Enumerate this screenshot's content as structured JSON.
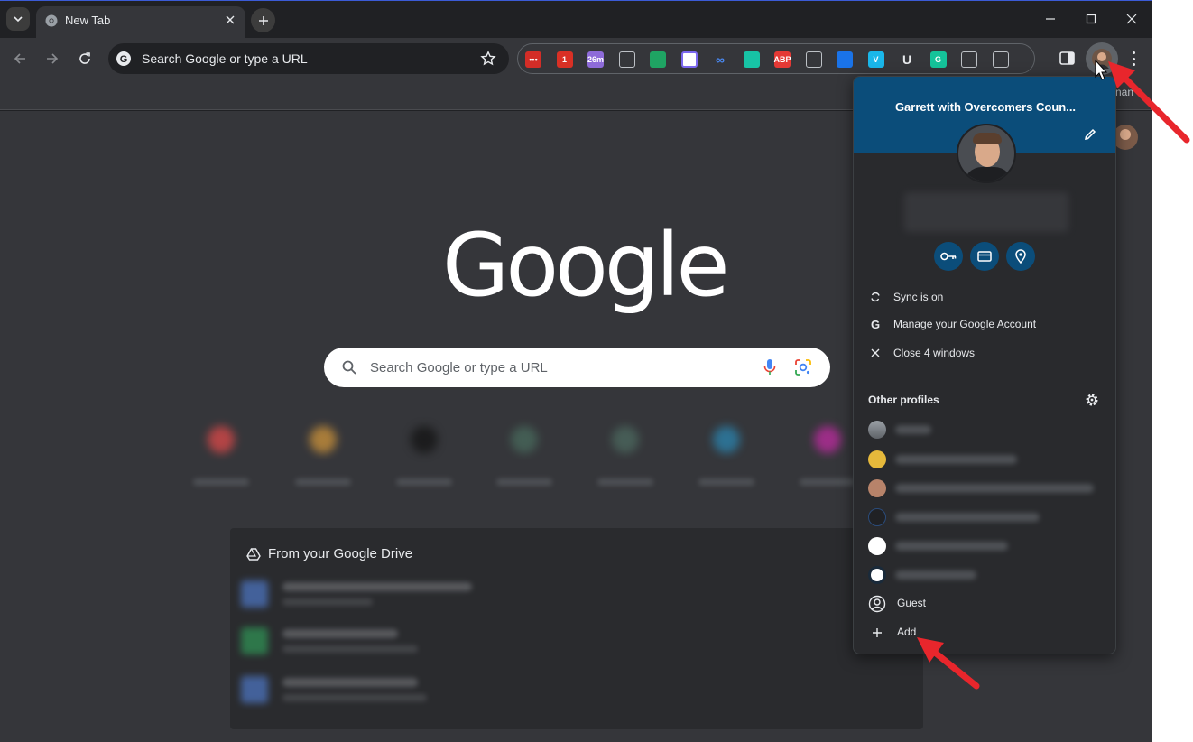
{
  "tab": {
    "title": "New Tab"
  },
  "omnibox": {
    "placeholder_text": "Search Google or type a URL"
  },
  "extensions": [
    {
      "name": "lastpass-icon",
      "color": "#d32d27",
      "label": "•••"
    },
    {
      "name": "gmail-checker-icon",
      "color": "#d93025",
      "label": "1"
    },
    {
      "name": "calendar-icon",
      "color": "#8e6bd9",
      "label": "26m"
    },
    {
      "name": "screenshot-icon",
      "color": "#5f6368",
      "label": ""
    },
    {
      "name": "google-drive-icon",
      "color": "#1fa463",
      "label": ""
    },
    {
      "name": "clickup-icon",
      "color": "#ffffff",
      "label": ""
    },
    {
      "name": "link-icon",
      "color": "#4a8af4",
      "label": ""
    },
    {
      "name": "fireflies-icon",
      "color": "#17c3a5",
      "label": ""
    },
    {
      "name": "adblock-icon",
      "color": "#e53935",
      "label": "ABP"
    },
    {
      "name": "loom-icon",
      "color": "#5f6368",
      "label": ""
    },
    {
      "name": "tag-icon",
      "color": "#1a73e8",
      "label": ""
    },
    {
      "name": "vimeo-icon",
      "color": "#1ab7ea",
      "label": "V"
    },
    {
      "name": "u-extension-icon",
      "color": "#9aa0a6",
      "label": "U"
    },
    {
      "name": "grammarly-icon",
      "color": "#15c39a",
      "label": "G"
    },
    {
      "name": "code-icon",
      "color": "#5f6368",
      "label": ""
    },
    {
      "name": "puzzle-icon",
      "color": "#5f6368",
      "label": ""
    }
  ],
  "ntp": {
    "logo_text": "Google",
    "search_placeholder": "Search Google or type a URL",
    "drive_title": "From your Google Drive",
    "name_fragment": "nan"
  },
  "popup": {
    "profile_name": "Garrett with Overcomers Coun...",
    "actions": [
      {
        "name": "sync-icon",
        "label": "Sync is on"
      },
      {
        "name": "google-g-icon",
        "label": "Manage your Google Account"
      },
      {
        "name": "close-icon",
        "label": "Close 4 windows"
      }
    ],
    "other_profiles_title": "Other profiles",
    "guest_label": "Guest",
    "add_label": "Add"
  },
  "colors": {
    "popup_banner": "#0b4d7a",
    "window_bg": "#202124",
    "page_bg": "#35363a",
    "annotation_arrow": "#e8262c"
  }
}
